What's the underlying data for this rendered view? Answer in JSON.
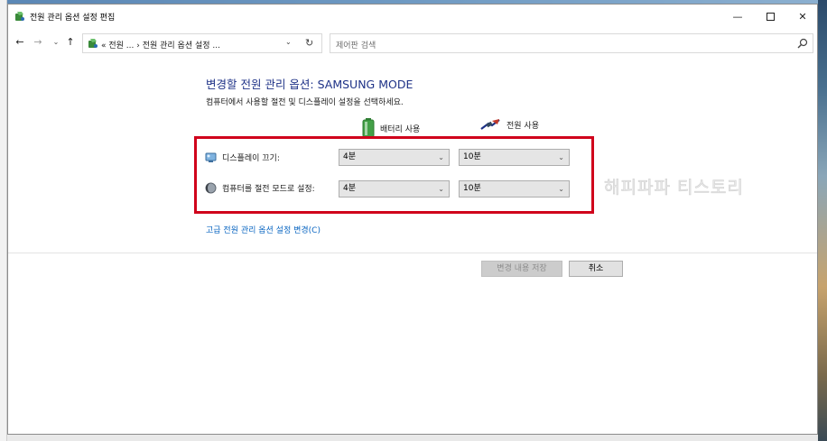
{
  "window": {
    "title": "전원 관리 옵션 설정 편집",
    "controls": {
      "minimize": "—",
      "maximize": "",
      "close": "✕"
    }
  },
  "addressbar": {
    "path": "« 전원 ... › 전원 관리 옵션 설정 ...",
    "search_placeholder": "제어판 검색"
  },
  "main": {
    "heading": "변경할 전원 관리 옵션: SAMSUNG MODE",
    "subheading": "컴퓨터에서 사용할 절전 및 디스플레이 설정을 선택하세요.",
    "columns": {
      "battery": "배터리 사용",
      "plugged_in": "전원 사용"
    },
    "settings": [
      {
        "label": "디스플레이 끄기:",
        "battery": "4분",
        "plugged_in": "10분"
      },
      {
        "label": "컴퓨터를 절전 모드로 설정:",
        "battery": "4분",
        "plugged_in": "10분"
      }
    ],
    "advanced_link": "고급 전원 관리 옵션 설정 변경(C)",
    "watermark": "해피파파 티스토리",
    "buttons": {
      "save": "변경 내용 저장",
      "cancel": "취소"
    }
  },
  "colors": {
    "heading": "#1e3287",
    "link": "#0a66c2",
    "highlight_box": "#d0021b"
  }
}
